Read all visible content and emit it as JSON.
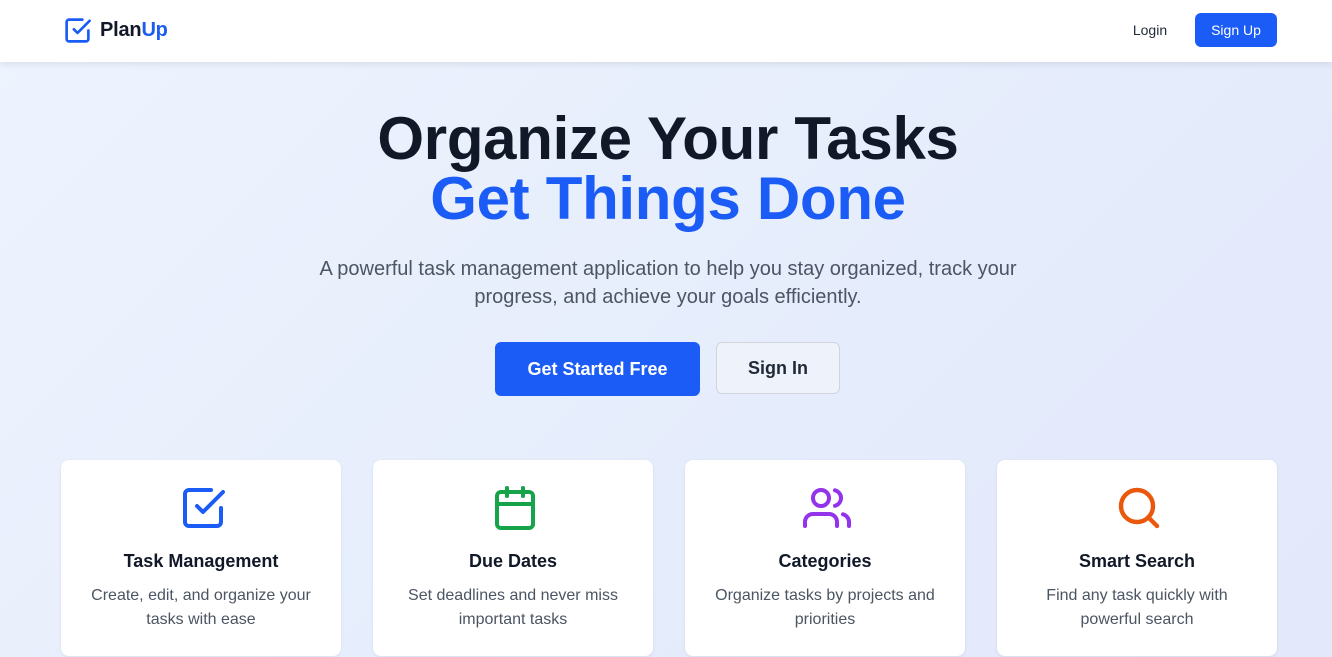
{
  "brand": {
    "name_part1": "Plan",
    "name_part2": "Up",
    "icon": "checkbox-check-icon"
  },
  "nav": {
    "login_label": "Login",
    "signup_label": "Sign Up"
  },
  "hero": {
    "title_line1": "Organize Your Tasks",
    "title_line2": "Get Things Done",
    "subtitle": "A powerful task management application to help you stay organized, track your progress, and achieve your goals efficiently.",
    "primary_cta": "Get Started Free",
    "secondary_cta": "Sign In"
  },
  "features": [
    {
      "icon": "checkbox-check-icon",
      "icon_color": "#1a5cf5",
      "title": "Task Management",
      "description": "Create, edit, and organize your tasks with ease"
    },
    {
      "icon": "calendar-icon",
      "icon_color": "#16a34a",
      "title": "Due Dates",
      "description": "Set deadlines and never miss important tasks"
    },
    {
      "icon": "users-icon",
      "icon_color": "#9333ea",
      "title": "Categories",
      "description": "Organize tasks by projects and priorities"
    },
    {
      "icon": "search-icon",
      "icon_color": "#ea580c",
      "title": "Smart Search",
      "description": "Find any task quickly with powerful search"
    }
  ],
  "colors": {
    "accent": "#1a5cf5",
    "heading": "#111827",
    "body_text": "#4b5563"
  }
}
